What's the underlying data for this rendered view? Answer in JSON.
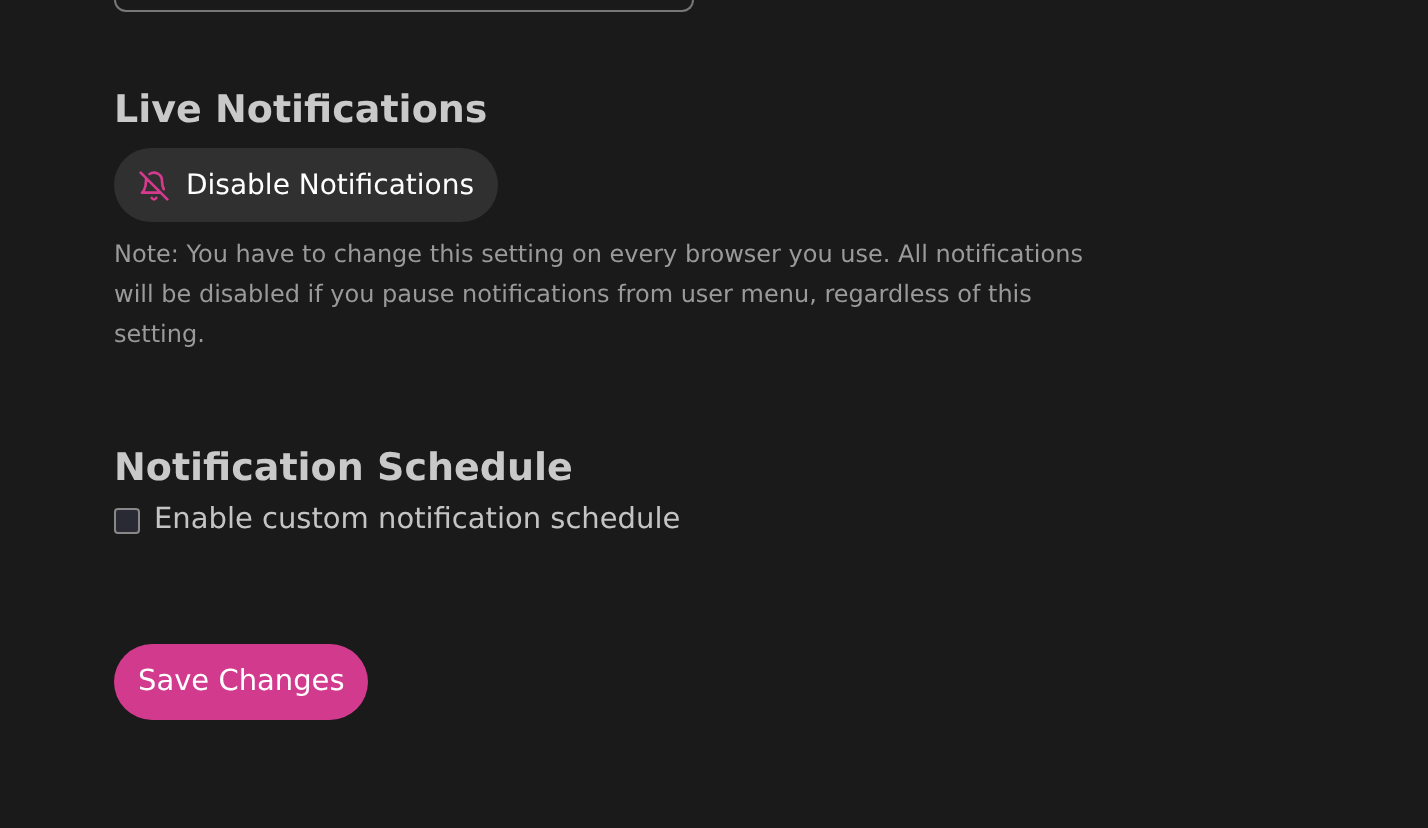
{
  "live_notifications": {
    "title": "Live Notifications",
    "button": {
      "label": "Disable Notifications"
    },
    "note": "Note: You have to change this setting on every browser you use. All notifications will be disabled if you pause notifications from user menu, regardless of this setting."
  },
  "notification_schedule": {
    "title": "Notification Schedule",
    "checkbox": {
      "label": "Enable custom notification schedule",
      "checked": false
    }
  },
  "save_button": {
    "label": "Save Changes"
  }
}
